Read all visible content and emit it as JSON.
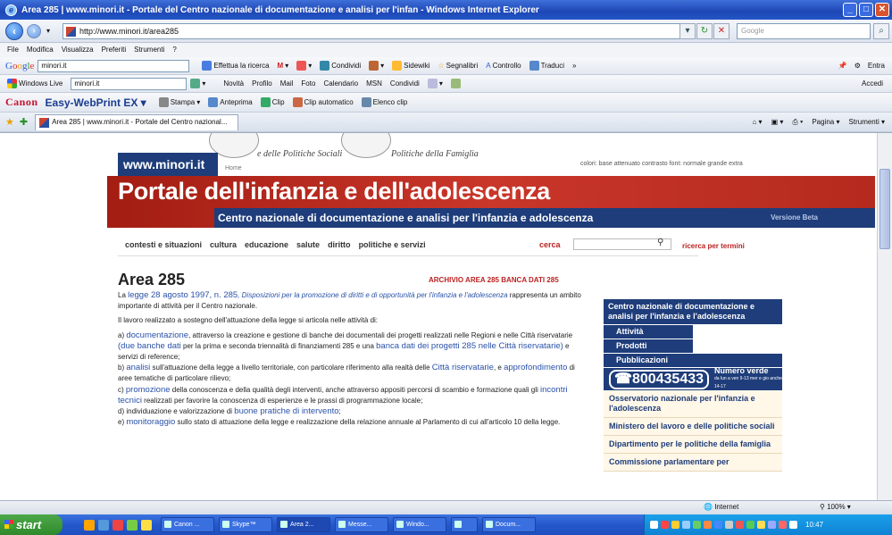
{
  "window": {
    "title": "Area 285 | www.minori.it - Portale del Centro nazionale di documentazione e analisi per l'infan - Windows Internet Explorer"
  },
  "address": {
    "url": "http://www.minori.it/area285",
    "search_placeholder": "Google"
  },
  "menu": [
    "File",
    "Modifica",
    "Visualizza",
    "Preferiti",
    "Strumenti",
    "?"
  ],
  "google_toolbar": {
    "logo": "Google",
    "query": "minori.it",
    "items": [
      "Effettua la ricerca",
      "Condividi",
      "Sidewiki",
      "Segnalibri",
      "Controllo",
      "Traduci",
      "»"
    ],
    "right_label": "Entra"
  },
  "live_toolbar": {
    "label": "Windows Live",
    "query": "minori.it",
    "items": [
      "Novità",
      "Profilo",
      "Mail",
      "Foto",
      "Calendario",
      "MSN",
      "Condividi"
    ],
    "right_label": "Accedi"
  },
  "canon_toolbar": {
    "brand": "Canon",
    "product": "Easy-WebPrint EX",
    "items": [
      "Stampa",
      "Anteprima",
      "Clip",
      "Clip automatico",
      "Elenco clip"
    ]
  },
  "tab_bar": {
    "tab_label": "Area 285 | www.minori.it - Portale del Centro nazional...",
    "right_items": [
      "Pagina",
      "Strumenti"
    ]
  },
  "site": {
    "header_script_left": "e delle Politiche Sociali",
    "header_script_right": "Politiche della Famiglia",
    "site_tag": "www.minori.it",
    "home_link": "Home",
    "color_options": "colori: base attenuato contrasto  font: normale grande extra",
    "title": "Portale dell'infanzia e dell'adolescenza",
    "subtitle": "Centro nazionale di documentazione e analisi per l'infanzia e adolescenza",
    "subtitle_right": "Versione Beta",
    "nav": [
      "contesti e situazioni",
      "cultura",
      "educazione",
      "salute",
      "diritto",
      "politiche e servizi"
    ],
    "search_label": "cerca",
    "search_value": "",
    "advanced_search": "ricerca per termini"
  },
  "article": {
    "heading": "Area 285",
    "archive_links": "ARCHIVIO AREA 285   BANCA DATI 285",
    "intro_pre": "La ",
    "intro_link": "legge 28 agosto 1997, n. 285",
    "intro_italic": ", Disposizioni per la promozione di diritti e di opportunità per l'infanzia e l'adolescenza",
    "intro_post": " rappresenta un ambito importante di attività per il Centro nazionale.",
    "p1": "Il lavoro realizzato a sostegno dell'attuazione della legge si articola nelle attività di:",
    "a_pre": "a) ",
    "a_link": "documentazione",
    "a_text": ", attraverso la creazione e gestione di banche dei documentali dei progetti realizzati nelle Regioni e nelle Città riservatarie ",
    "a_link2": "(due banche dati",
    "a_text2": " per la prima e seconda triennalità di finanziamenti 285 e una ",
    "a_link3": "banca dati dei progetti 285 nelle Città riservatarie)",
    "a_text3": " e servizi di reference;",
    "b_pre": "b) ",
    "b_link": "analisi",
    "b_text": " sull'attuazione della legge a livello territoriale, con particolare riferimento alla realtà delle ",
    "b_link2": "Città riservatarie",
    "b_text2": ", e ",
    "b_link3": "approfondimento",
    "b_text3": " di aree tematiche di particolare rilievo;",
    "c_pre": "c) ",
    "c_link": "promozione",
    "c_text": " della conoscenza e della qualità degli interventi, anche attraverso appositi percorsi di scambio e formazione quali gli ",
    "c_link2": "incontri tecnici",
    "c_text2": " realizzati per favorire la conoscenza di esperienze e le prassi di programmazione locale;",
    "d_text": "d) individuazione e valorizzazione di ",
    "d_link": "buone pratiche di intervento",
    "d_text2": ";",
    "e_pre": "e) ",
    "e_link": "monitoraggio",
    "e_text": " sullo stato di attuazione della legge e realizzazione della relazione annuale al Parlamento di cui all'articolo 10 della legge."
  },
  "sidebar": {
    "header": "Centro nazionale di documentazione e analisi per l'infanzia e l'adolescenza",
    "items": [
      "Attività",
      "Prodotti",
      "Pubblicazioni"
    ],
    "phone": "800435433",
    "phone_label": "Numero verde",
    "phone_hours": "da lun a ven 9-13 mer e gio anche 14-17",
    "links": [
      "Osservatorio nazionale per l'infanzia e l'adolescenza",
      "Ministero del lavoro e delle politiche sociali",
      "Dipartimento per le politiche della famiglia",
      "Commissione parlamentare per"
    ]
  },
  "status": {
    "zone": "Internet",
    "zoom": "100%"
  },
  "taskbar": {
    "start": "start",
    "tasks": [
      "Canon ...",
      "Skype™",
      "Area 2...",
      "Messe...",
      "Windo...",
      "",
      "Docum..."
    ],
    "clock": "10:47"
  }
}
